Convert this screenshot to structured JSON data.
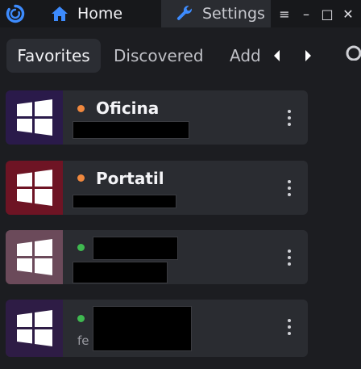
{
  "titlebar": {
    "logo_icon": "app-logo-ring",
    "tabs": [
      {
        "label": "Home",
        "icon": "home-icon",
        "active": true
      },
      {
        "label": "Settings",
        "icon": "wrench-icon",
        "active": false
      }
    ],
    "window_controls": {
      "menu": "≡",
      "minimize": "–",
      "maximize": "□",
      "close": "✕"
    }
  },
  "filter_tabs": [
    {
      "label": "Favorites",
      "active": true
    },
    {
      "label": "Discovered",
      "active": false
    },
    {
      "label": "Add",
      "active": false
    }
  ],
  "devices": [
    {
      "name": "Oficina",
      "subtitle": "",
      "tile_color": "#2a1a4a",
      "status_color": "#f0883e"
    },
    {
      "name": "Portatil",
      "subtitle": "",
      "tile_color": "#6e1424",
      "status_color": "#f0883e"
    },
    {
      "name": "",
      "subtitle": "",
      "tile_color": "#6b4a5a",
      "status_color": "#3fb950"
    },
    {
      "name": "",
      "subtitle": "fe",
      "tile_color": "#2e1c45",
      "status_color": "#3fb950"
    }
  ],
  "colors": {
    "accent": "#3d8bfd",
    "online": "#3fb950",
    "away": "#f0883e"
  }
}
